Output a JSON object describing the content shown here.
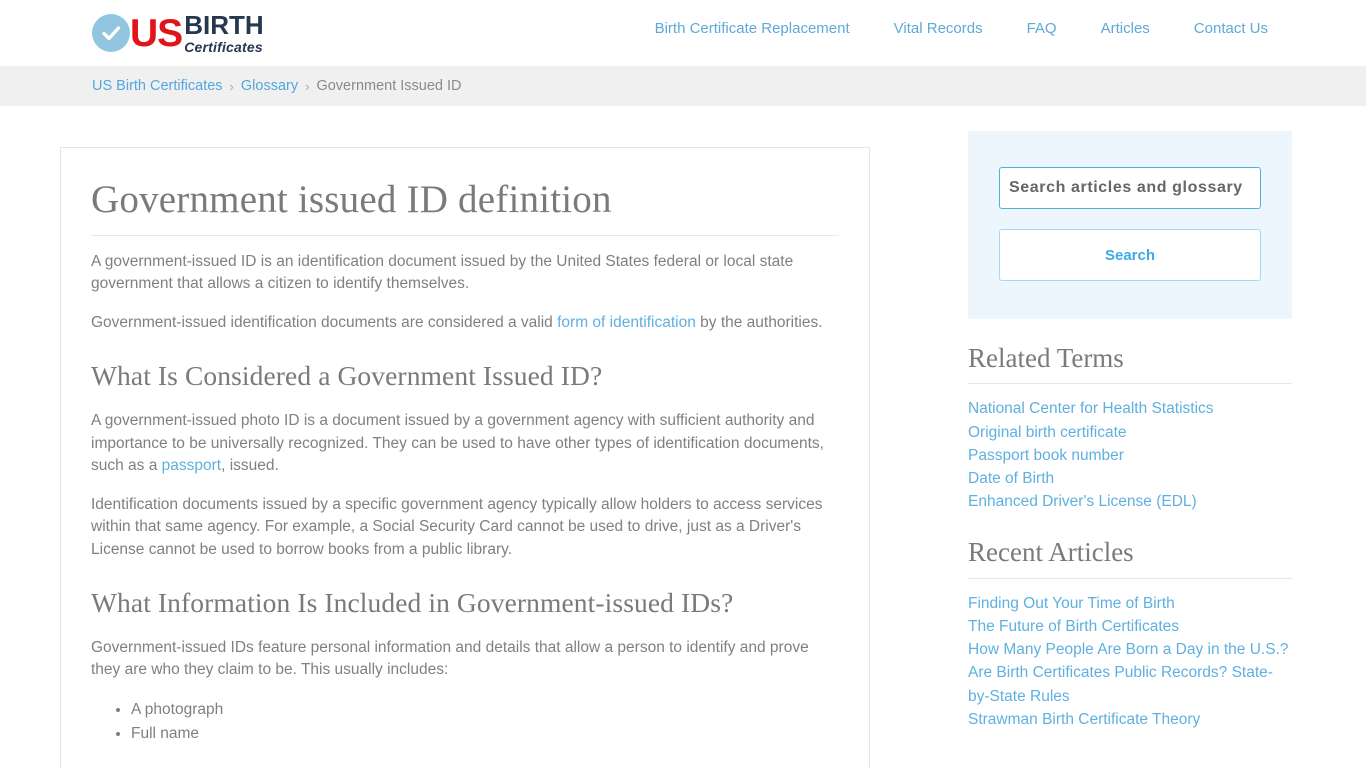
{
  "header": {
    "logo": {
      "icon": "check-circle-icon",
      "us": "US",
      "birth": "BIRTH",
      "certificates": "Certificates"
    },
    "nav": [
      {
        "label": "Birth Certificate Replacement"
      },
      {
        "label": "Vital Records"
      },
      {
        "label": "FAQ"
      },
      {
        "label": "Articles"
      },
      {
        "label": "Contact Us"
      }
    ]
  },
  "breadcrumb": {
    "items": [
      {
        "label": "US Birth Certificates",
        "link": true
      },
      {
        "label": "Glossary",
        "link": true
      },
      {
        "label": "Government Issued ID",
        "link": false
      }
    ],
    "separator": "›"
  },
  "main": {
    "title": "Government issued ID definition",
    "intro_1": "A government-issued ID is an identification document issued by the United States federal or local state government that allows a citizen to identify themselves.",
    "intro_2_before": "Government-issued identification documents are considered a valid ",
    "intro_2_link": "form of identification",
    "intro_2_after": " by the authorities.",
    "section_1": {
      "heading": "What Is Considered a Government Issued ID?",
      "p1_before": "A government-issued photo ID is a document issued by a government agency with sufficient authority and importance to be universally recognized. They can be used to have other types of identification documents, such as a ",
      "p1_link": "passport",
      "p1_after": ", issued.",
      "p2": "Identification documents issued by a specific government agency typically allow holders to access services within that same agency. For example, a Social Security Card cannot be used to drive, just as a Driver's License cannot be used to borrow books from a public library."
    },
    "section_2": {
      "heading": "What Information Is Included in Government-issued IDs?",
      "p1": "Government-issued IDs feature personal information and details that allow a person to identify and prove they are who they claim to be. This usually includes:",
      "list": [
        "A photograph",
        "Full name"
      ]
    }
  },
  "sidebar": {
    "search": {
      "placeholder": "Search articles and glossary",
      "value": "",
      "button_label": "Search"
    },
    "related_terms": {
      "heading": "Related Terms",
      "items": [
        "National Center for Health Statistics",
        "Original birth certificate",
        "Passport book number",
        "Date of Birth",
        "Enhanced Driver's License (EDL)"
      ]
    },
    "recent_articles": {
      "heading": "Recent Articles",
      "items": [
        "Finding Out Your Time of Birth",
        "The Future of Birth Certificates",
        "How Many People Are Born a Day in the U.S.?",
        "Are Birth Certificates Public Records? State-by-State Rules",
        "Strawman Birth Certificate Theory"
      ]
    }
  },
  "colors": {
    "brand_red": "#e3131b",
    "brand_navy": "#26374f",
    "link_blue": "#5fb0e0",
    "accent_teal": "#54b2d8",
    "panel_bg": "#eef6fd",
    "breadcrumb_bg": "#f0f0f0"
  }
}
